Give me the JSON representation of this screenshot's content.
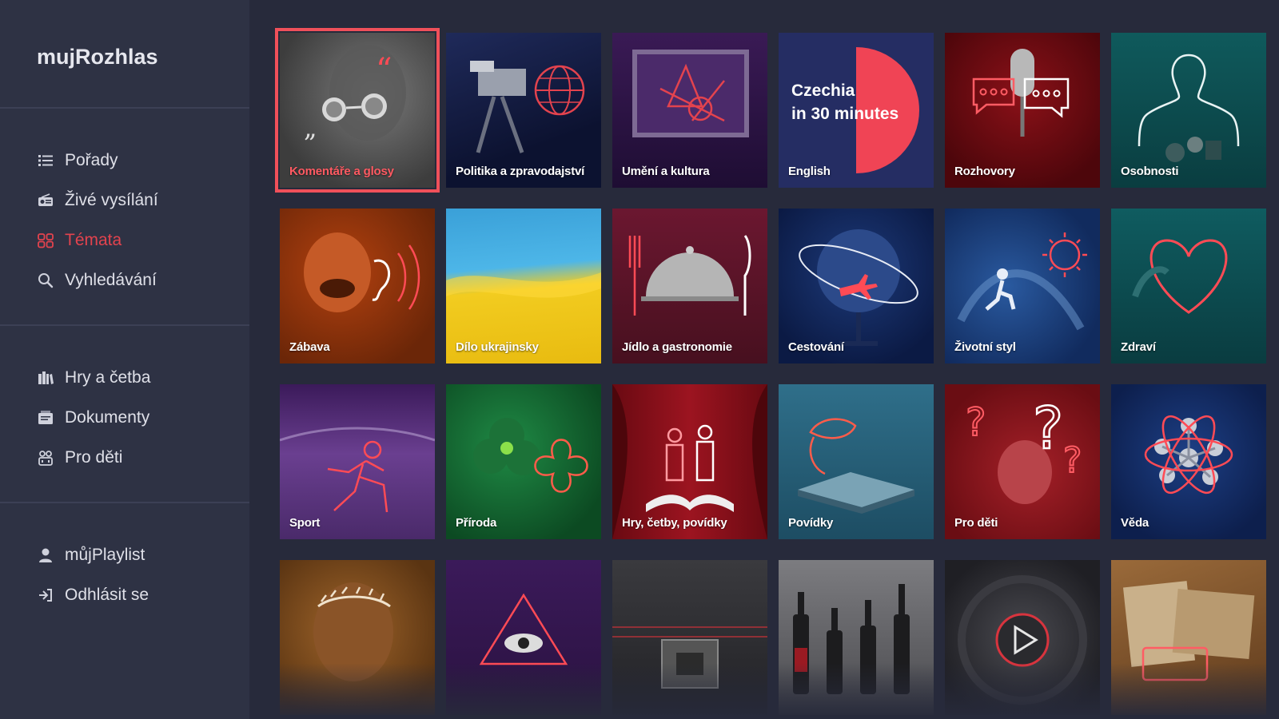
{
  "app": {
    "title": "mujRozhlas"
  },
  "nav": {
    "primary": [
      {
        "label": "Pořady",
        "icon": "list-icon"
      },
      {
        "label": "Živé vysílání",
        "icon": "radio-icon"
      },
      {
        "label": "Témata",
        "icon": "topics-icon",
        "active": true
      },
      {
        "label": "Vyhledávání",
        "icon": "search-icon"
      }
    ],
    "secondary": [
      {
        "label": "Hry a četba",
        "icon": "books-icon"
      },
      {
        "label": "Dokumenty",
        "icon": "documents-icon"
      },
      {
        "label": "Pro děti",
        "icon": "kids-icon"
      }
    ],
    "account": [
      {
        "label": "můjPlaylist",
        "icon": "user-icon"
      },
      {
        "label": "Odhlásit se",
        "icon": "logout-icon"
      }
    ]
  },
  "tiles": [
    {
      "label": "Komentáře a glosy",
      "selected": true
    },
    {
      "label": "Politika a zpravodajství"
    },
    {
      "label": "Umění a kultura"
    },
    {
      "label": "English",
      "title_line1": "Czechia",
      "title_line2": "in 30 minutes"
    },
    {
      "label": "Rozhovory"
    },
    {
      "label": "Osobnosti"
    },
    {
      "label": "Zábava"
    },
    {
      "label": "Dílo ukrajinsky"
    },
    {
      "label": "Jídlo a gastronomie"
    },
    {
      "label": "Cestování"
    },
    {
      "label": "Životní styl"
    },
    {
      "label": "Zdraví"
    },
    {
      "label": "Sport"
    },
    {
      "label": "Příroda"
    },
    {
      "label": "Hry, četby, povídky"
    },
    {
      "label": "Povídky"
    },
    {
      "label": "Pro děti"
    },
    {
      "label": "Věda"
    },
    {
      "label": ""
    },
    {
      "label": ""
    },
    {
      "label": ""
    },
    {
      "label": ""
    },
    {
      "label": ""
    },
    {
      "label": ""
    }
  ],
  "colors": {
    "accent": "#e3434e",
    "sidebar": "#2e3244",
    "background": "#272a3b"
  }
}
